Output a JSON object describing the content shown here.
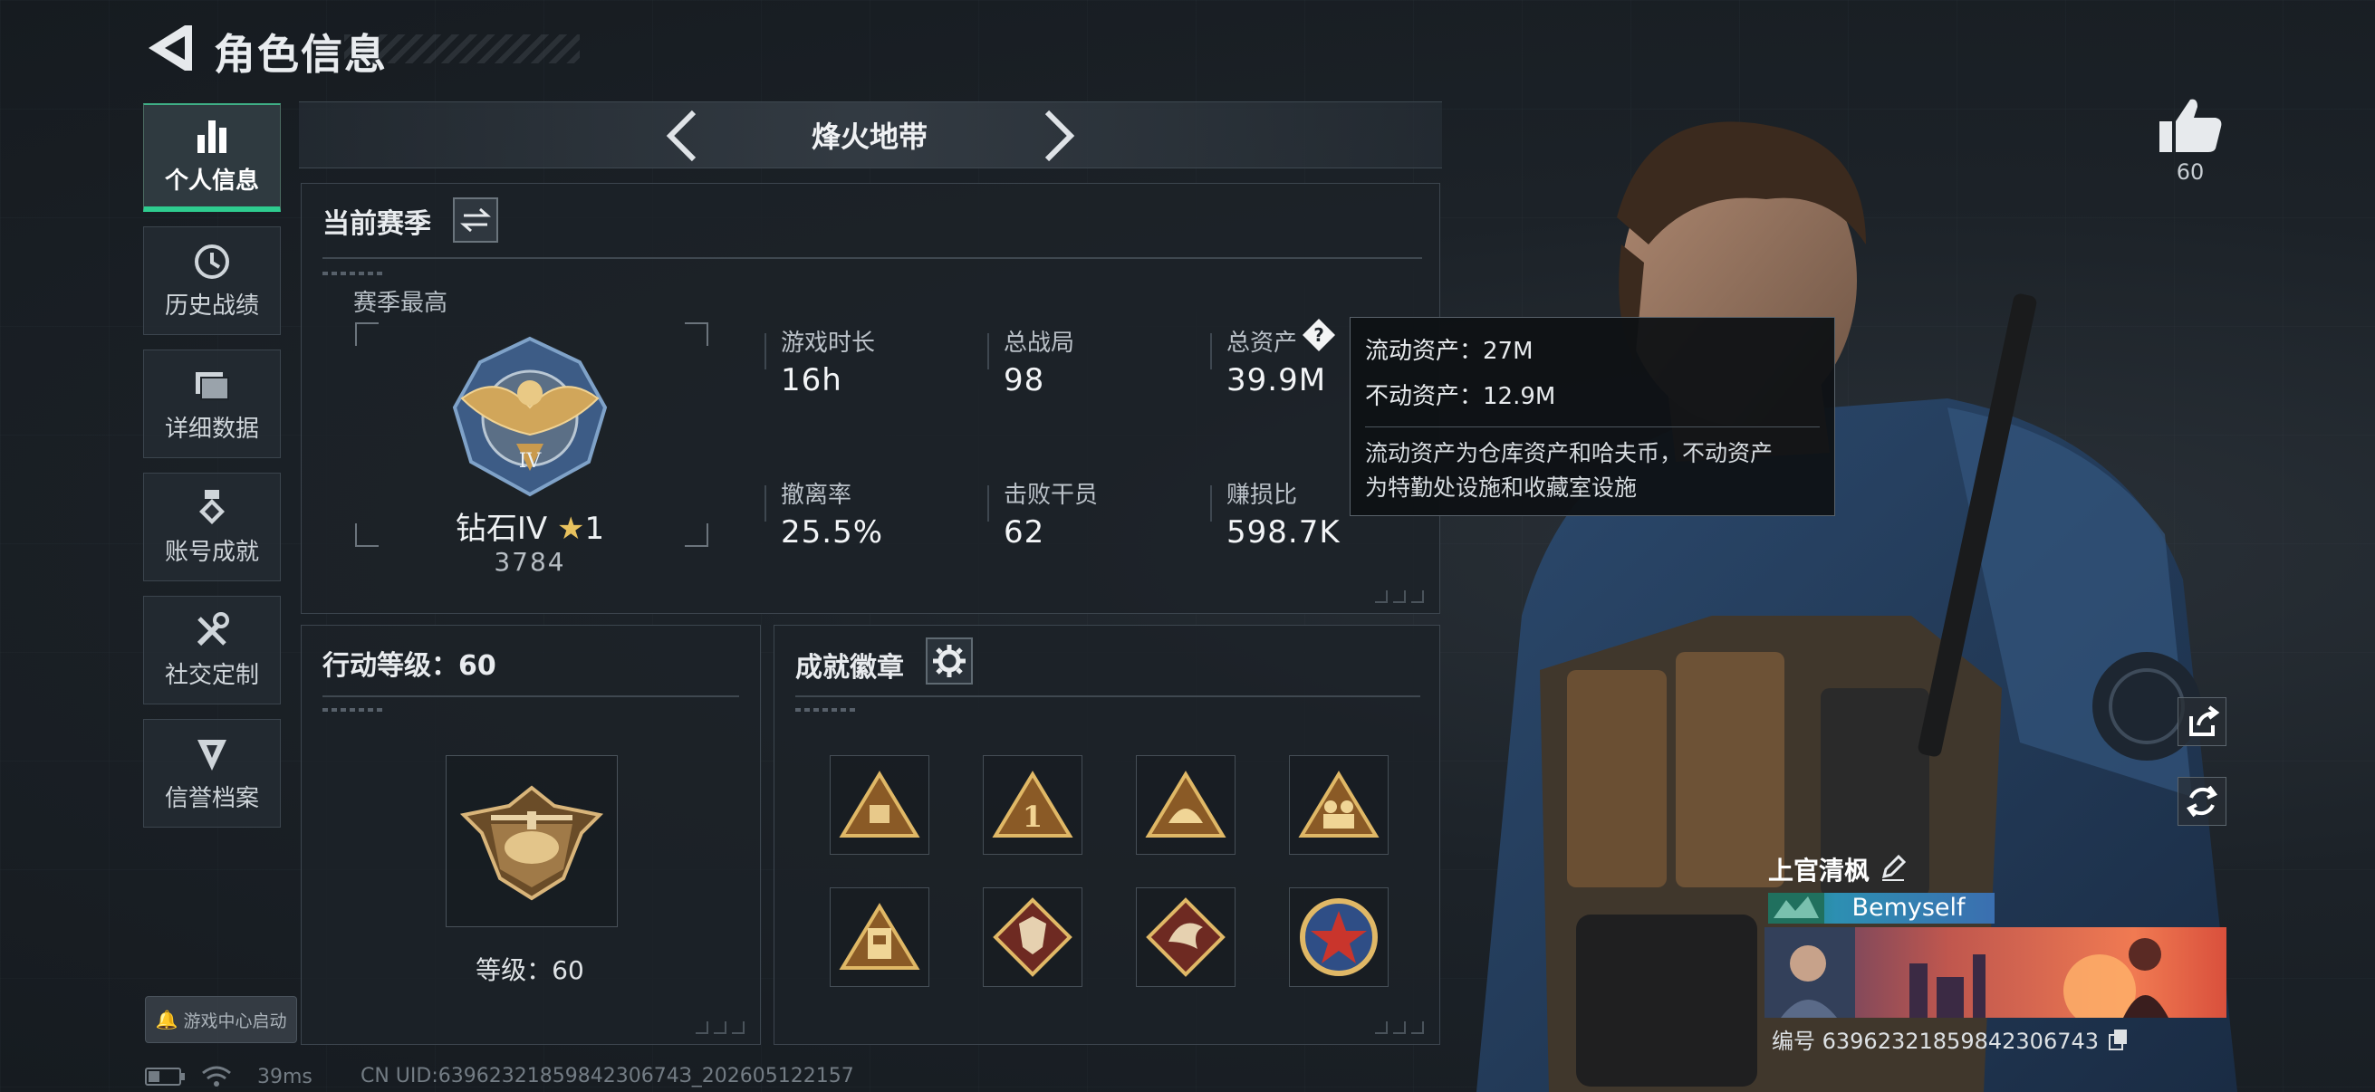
{
  "header": {
    "title": "角色信息"
  },
  "sidebar": {
    "items": [
      {
        "label": "个人信息",
        "icon": "bar-chart-icon",
        "active": true
      },
      {
        "label": "历史战绩",
        "icon": "history-clock-icon"
      },
      {
        "label": "详细数据",
        "icon": "folder-icon"
      },
      {
        "label": "账号成就",
        "icon": "medal-icon"
      },
      {
        "label": "社交定制",
        "icon": "tools-icon"
      },
      {
        "label": "信誉档案",
        "icon": "reputation-icon"
      }
    ],
    "game_center": "游戏中心启动"
  },
  "status_bar": {
    "ping": "39ms",
    "uid": "CN UID:6396232185984230674З_202605122157"
  },
  "mode": {
    "title": "烽火地带"
  },
  "season": {
    "title": "当前赛季",
    "peak_label": "赛季最高",
    "rank_name": "钻石IV",
    "rank_stars": "1",
    "rank_score": "3784",
    "stats": [
      {
        "label": "游戏时长",
        "value": "16h"
      },
      {
        "label": "总战局",
        "value": "98"
      },
      {
        "label": "总资产",
        "value": "39.9M"
      },
      {
        "label": "撤离率",
        "value": "25.5%"
      },
      {
        "label": "击败干员",
        "value": "62"
      },
      {
        "label": "赚损比",
        "value": "598.7K"
      }
    ]
  },
  "tooltip": {
    "liquid": "流动资产：27M",
    "fixed": "不动资产：12.9M",
    "desc_line1": "流动资产为仓库资产和哈夫币，不动资产",
    "desc_line2": "为特勤处设施和收藏室设施"
  },
  "action_level": {
    "title": "行动等级：60",
    "level_text": "等级：60"
  },
  "achievements": {
    "title": "成就徽章",
    "badges": [
      "badge-triangle-suitcase",
      "badge-triangle-one",
      "badge-triangle-helmet",
      "badge-triangle-soldiers",
      "badge-triangle-building",
      "badge-diamond-wolf",
      "badge-diamond-dragon",
      "badge-star-round"
    ]
  },
  "profile": {
    "likes": "60",
    "player_name": "上官清枫",
    "club": "Bemyself",
    "player_uid": "编号 639623218598423067​43"
  },
  "colors": {
    "accent": "#2ecc8f",
    "gold": "#c9a45c",
    "panel": "#1c2228"
  }
}
